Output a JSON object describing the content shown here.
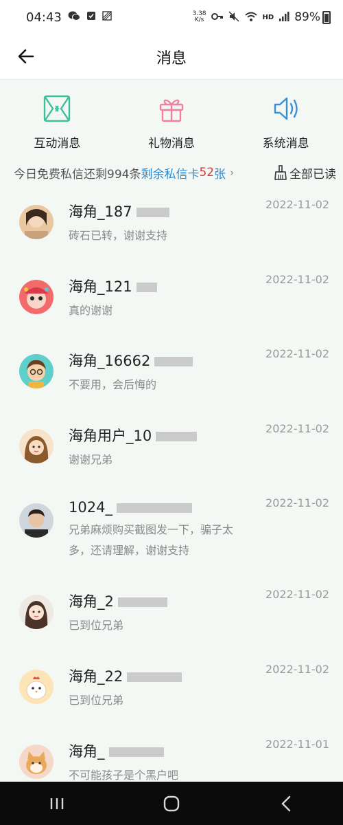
{
  "status_bar": {
    "time": "04:43",
    "speed_value": "3.38",
    "speed_unit": "K/s",
    "hd": "HD",
    "battery": "89%"
  },
  "header": {
    "title": "消息"
  },
  "categories": [
    {
      "label": "互动消息",
      "icon": "interaction-icon",
      "color": "#3cbf9a"
    },
    {
      "label": "礼物消息",
      "icon": "gift-icon",
      "color": "#ef7fa3"
    },
    {
      "label": "系统消息",
      "icon": "speaker-icon",
      "color": "#3a8fd8"
    }
  ],
  "info": {
    "free_text": "今日免费私信还剩994条",
    "card_prefix": "剩余私信卡",
    "card_count": "52",
    "card_suffix": "张",
    "read_all": "全部已读"
  },
  "messages": [
    {
      "name": "海角_187",
      "preview": "砖石已转，谢谢支持",
      "date": "2022-11-02"
    },
    {
      "name": "海角_121",
      "preview": "真的谢谢",
      "date": "2022-11-02"
    },
    {
      "name": "海角_16662",
      "preview": "不要用，会后悔的",
      "date": "2022-11-02"
    },
    {
      "name": "海角用户_10",
      "preview": "谢谢兄弟",
      "date": "2022-11-02"
    },
    {
      "name": "1024_",
      "preview": "兄弟麻烦购买截图发一下，骗子太多，还请理解，谢谢支持",
      "date": "2022-11-02"
    },
    {
      "name": "海角_2",
      "preview": "已到位兄弟",
      "date": "2022-11-02"
    },
    {
      "name": "海角_22",
      "preview": "已到位兄弟",
      "date": "2022-11-02"
    },
    {
      "name": "海角_",
      "preview": "不可能孩子是个黑户吧",
      "date": "2022-11-01"
    }
  ],
  "colors": {
    "accent_blue": "#2a8bd6",
    "accent_red": "#d23b3b",
    "background": "#f3f8f5"
  }
}
